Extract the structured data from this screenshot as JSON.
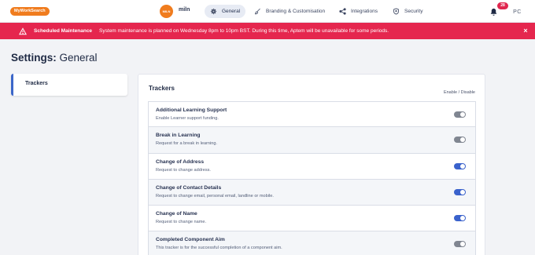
{
  "header": {
    "brand": "MyWorkSearch",
    "org_logo_text": "MILN",
    "org_name": "miln",
    "nav": [
      {
        "label": "General",
        "icon": "gear-icon",
        "active": true
      },
      {
        "label": "Branding & Customisation",
        "icon": "brush-icon",
        "active": false
      },
      {
        "label": "Integrations",
        "icon": "integrations-icon",
        "active": false
      },
      {
        "label": "Security",
        "icon": "shield-icon",
        "active": false
      }
    ],
    "notification_count": "28",
    "avatar_initials": "PC"
  },
  "banner": {
    "title": "Scheduled Maintenance",
    "message": "System maintenance is planned on Wednesday 8pm to 10pm BST. During this time, Aptem will be unavailable for some periods.",
    "close": "×",
    "color": "#e5264e"
  },
  "page": {
    "title_bold": "Settings:",
    "title_rest": " General"
  },
  "sidebar": {
    "items": [
      {
        "label": "Trackers",
        "active": true
      }
    ]
  },
  "panel": {
    "title": "Trackers",
    "hint": "Enable / Disable",
    "rows": [
      {
        "title": "Additional Learning Support",
        "desc": "Enable Learner support funding.",
        "enabled": false
      },
      {
        "title": "Break in Learning",
        "desc": "Request for a break in learning.",
        "enabled": false
      },
      {
        "title": "Change of Address",
        "desc": "Request to change address.",
        "enabled": true
      },
      {
        "title": "Change of Contact Details",
        "desc": "Request to change email, personal email, landline or mobile.",
        "enabled": true
      },
      {
        "title": "Change of Name",
        "desc": "Request to change name.",
        "enabled": true
      },
      {
        "title": "Completed Component Aim",
        "desc": "This tracker is for the successful completion of a component aim.",
        "enabled": false
      }
    ]
  },
  "colors": {
    "accent": "#3a62cc",
    "brand_orange": "#f07c1e",
    "toggle_off": "#808691"
  }
}
